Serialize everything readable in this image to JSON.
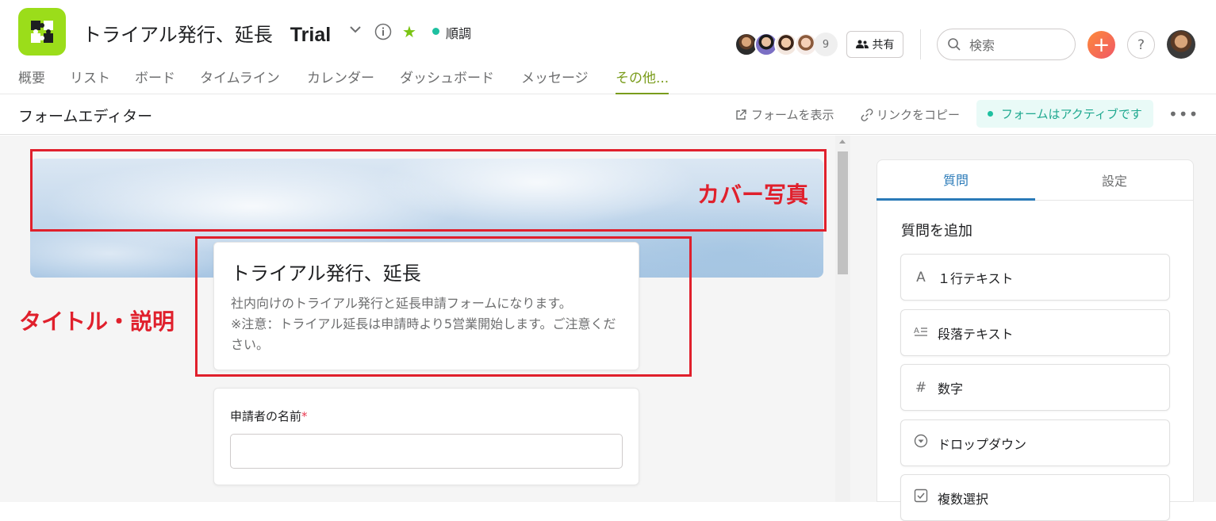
{
  "header": {
    "project_title": "トライアル発行、延長",
    "project_badge": "Trial",
    "status": "順調",
    "member_count": "9",
    "share_label": "共有",
    "search_placeholder": "検索",
    "add_label": "+",
    "help_label": "?"
  },
  "nav": {
    "tabs": [
      "概要",
      "リスト",
      "ボード",
      "タイムライン",
      "カレンダー",
      "ダッシュボード",
      "メッセージ",
      "その他..."
    ],
    "active": "その他..."
  },
  "toolbar": {
    "editor_title": "フォームエディター",
    "view_form": "フォームを表示",
    "copy_link": "リンクをコピー",
    "form_status": "フォームはアクティブです",
    "more": "•••"
  },
  "form": {
    "title": "トライアル発行、延長",
    "description_line1": "社内向けのトライアル発行と延長申請フォームになります。",
    "description_line2": "※注意：トライアル延長は申請時より5営業開始します。ご注意ください。",
    "questions": [
      {
        "label": "申請者の名前",
        "required_mark": "*",
        "value": ""
      }
    ]
  },
  "annotations": {
    "cover_label": "カバー写真",
    "title_label": "タイトル・説明"
  },
  "side_panel": {
    "tabs": [
      "質問",
      "設定"
    ],
    "active_tab": "質問",
    "heading": "質問を追加",
    "question_types": [
      {
        "label": "１行テキスト",
        "icon": "text-a-icon"
      },
      {
        "label": "段落テキスト",
        "icon": "paragraph-icon"
      },
      {
        "label": "数字",
        "icon": "hash-icon"
      },
      {
        "label": "ドロップダウン",
        "icon": "dropdown-icon"
      },
      {
        "label": "複数選択",
        "icon": "checkbox-icon"
      }
    ]
  },
  "colors": {
    "brand_green": "#9bdd1a",
    "active_tab": "#7a9c1c",
    "status_teal": "#1ec0a0",
    "annotation_red": "#e0202c",
    "accent_blue": "#2a7ab8"
  }
}
